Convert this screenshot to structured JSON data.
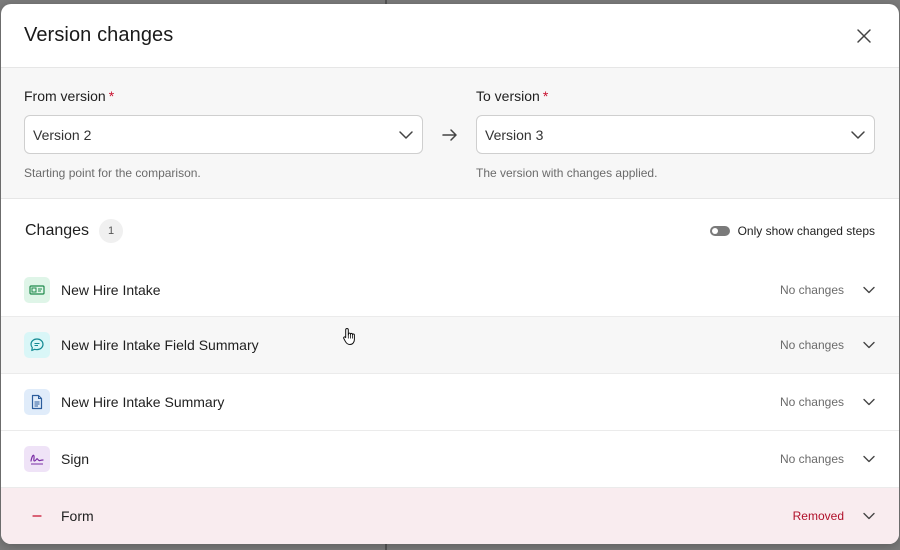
{
  "modal": {
    "title": "Version changes"
  },
  "from": {
    "label": "From version",
    "required_mark": "*",
    "value": "Version 2",
    "hint": "Starting point for the comparison."
  },
  "to": {
    "label": "To version",
    "required_mark": "*",
    "value": "Version 3",
    "hint": "The version with changes applied."
  },
  "changes": {
    "title": "Changes",
    "count": "1",
    "toggle_label": "Only show changed steps",
    "toggle_on": false
  },
  "steps": [
    {
      "name": "New Hire Intake",
      "status": "No changes",
      "icon": "id-card-icon",
      "icon_bg": "#dff5e8",
      "icon_color": "#1f8a4c"
    },
    {
      "name": "New Hire Intake Field Summary",
      "status": "No changes",
      "icon": "chat-bubble-icon",
      "icon_bg": "#d9f6f7",
      "icon_color": "#138a93"
    },
    {
      "name": "New Hire Intake Summary",
      "status": "No changes",
      "icon": "document-icon",
      "icon_bg": "#e0ecfa",
      "icon_color": "#2c5d9c"
    },
    {
      "name": "Sign",
      "status": "No changes",
      "icon": "signature-icon",
      "icon_bg": "#efe3f7",
      "icon_color": "#7a2ea5"
    },
    {
      "name": "Form",
      "status": "Removed",
      "icon": "minus-icon",
      "icon_bg": "transparent",
      "icon_color": "#c8102e"
    }
  ],
  "colors": {
    "required": "#c8102e",
    "removed_row_bg": "#f9ecef",
    "removed_text": "#b0102a"
  }
}
